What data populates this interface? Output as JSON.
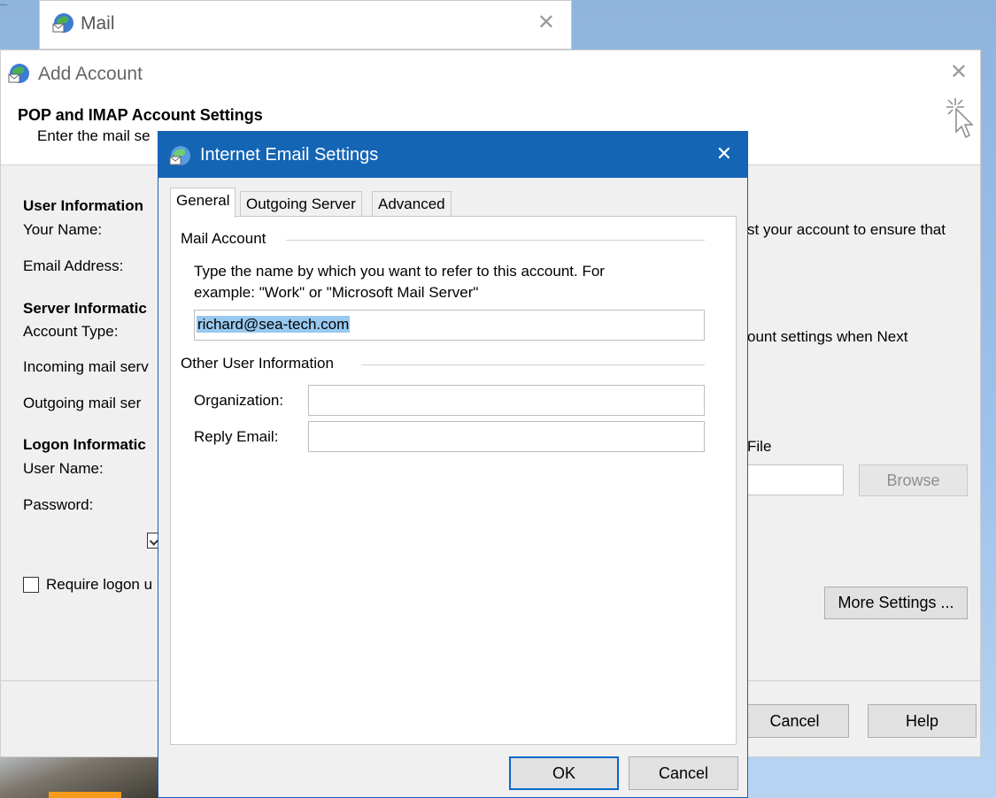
{
  "desktop": {
    "corner_text": "..."
  },
  "mail_window": {
    "title": "Mail",
    "close": "✕"
  },
  "add_account": {
    "title": "Add Account",
    "close": "✕",
    "heading": "POP and IMAP Account Settings",
    "subheading": "Enter the mail se",
    "sections": {
      "user_info": "User Information",
      "your_name": "Your Name:",
      "email_address": "Email Address:",
      "server_info": "Server Informatic",
      "account_type": "Account Type:",
      "incoming": "Incoming mail serv",
      "outgoing": "Outgoing mail ser",
      "logon_info": "Logon Informatic",
      "user_name": "User Name:",
      "password": "Password:",
      "require_logon": "Require logon u"
    },
    "right_text": {
      "test_account": "st your account to ensure that",
      "account_settings": "ount settings when Next",
      "file_label": "File"
    },
    "buttons": {
      "browse": "Browse",
      "more_settings": "More Settings ...",
      "cancel": "Cancel",
      "help": "Help"
    }
  },
  "internet_email_settings": {
    "title": "Internet Email Settings",
    "close": "✕",
    "tabs": [
      "General",
      "Outgoing Server",
      "Advanced"
    ],
    "active_tab": "General",
    "mail_account": {
      "group_label": "Mail Account",
      "description_line1": "Type the name by which you want to refer to this account. For",
      "description_line2": "example: \"Work\" or \"Microsoft Mail Server\"",
      "account_name_value": "richard@sea-tech.com"
    },
    "other_user_info": {
      "group_label": "Other User Information",
      "organization_label": "Organization:",
      "organization_value": "",
      "reply_email_label": "Reply Email:",
      "reply_email_value": ""
    },
    "buttons": {
      "ok": "OK",
      "cancel": "Cancel"
    }
  },
  "colors": {
    "titlebar_blue": "#1565b5",
    "selection": "#99c9ef"
  }
}
